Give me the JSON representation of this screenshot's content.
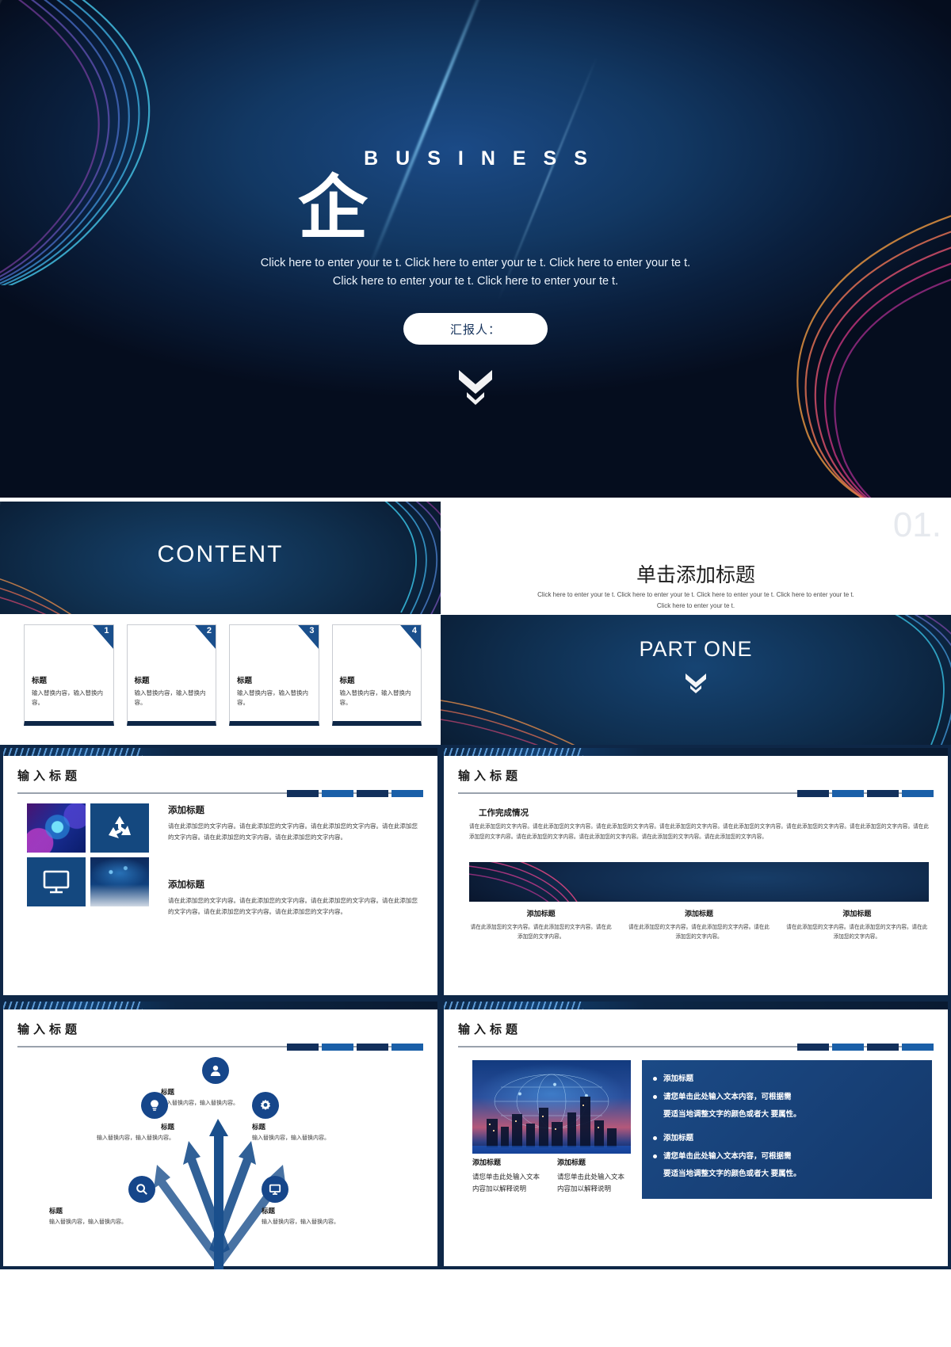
{
  "cover": {
    "word": "BUSINESS",
    "logo": "企",
    "subtitle": "Click here to enter your te t. Click here to enter your te t. Click here to enter your te t. Click here to enter your te t. Click here to enter your te t.",
    "presenter_label": "汇报人：",
    "colors": {
      "bg_deep": "#071428",
      "bg_blue": "#16436f",
      "accent_pink": "#c8336f",
      "accent_orange": "#e08a4a",
      "accent_cyan": "#35b6d8"
    }
  },
  "content_slide": {
    "hero_title": "CONTENT",
    "cards": [
      {
        "num": "1",
        "title": "标题",
        "text": "输入替换内容，输入替换内容。"
      },
      {
        "num": "2",
        "title": "标题",
        "text": "输入替换内容，输入替换内容。"
      },
      {
        "num": "3",
        "title": "标题",
        "text": "输入替换内容，输入替换内容。"
      },
      {
        "num": "4",
        "title": "标题",
        "text": "输入替换内容，输入替换内容。"
      }
    ]
  },
  "section_slide": {
    "number": "01.",
    "title": "单击添加标题",
    "subtitle": "Click here to enter your te t. Click here to enter your te t. Click here to enter your te t. Click here to enter your te t. Click here to enter your te t.",
    "band_title": "PART ONE"
  },
  "image_grid_slide": {
    "header": "输入标题",
    "tiles": [
      {
        "name": "globe-photo",
        "kind": "photo"
      },
      {
        "name": "recycle-icon",
        "kind": "icon"
      },
      {
        "name": "monitor-icon",
        "kind": "icon"
      },
      {
        "name": "network-hand-photo",
        "kind": "photo"
      }
    ],
    "blocks": [
      {
        "title": "添加标题",
        "text": "请在此添加您的文字内容。请在此添加您的文字内容。请在此添加您的文字内容。请在此添加您的文字内容。请在此添加您的文字内容。请在此添加您的文字内容。"
      },
      {
        "title": "添加标题",
        "text": "请在此添加您的文字内容。请在此添加您的文字内容。请在此添加您的文字内容。请在此添加您的文字内容。请在此添加您的文字内容。请在此添加您的文字内容。"
      }
    ]
  },
  "work_status_slide": {
    "header": "输入标题",
    "heading": "工作完成情况",
    "paragraph": "请在此添加您的文字内容。请在此添加您的文字内容。请在此添加您的文字内容。请在此添加您的文字内容。请在此添加您的文字内容。请在此添加您的文字内容。请在此添加您的文字内容。请在此添加您的文字内容。请在此添加您的文字内容。请在此添加您的文字内容。请在此添加您的文字内容。请在此添加您的文字内容。",
    "columns": [
      {
        "title": "添加标题",
        "text": "请在此添加您的文字内容。请在此添加您的文字内容。请在此添加您的文字内容。"
      },
      {
        "title": "添加标题",
        "text": "请在此添加您的文字内容。请在此添加您的文字内容。请在此添加您的文字内容。"
      },
      {
        "title": "添加标题",
        "text": "请在此添加您的文字内容。请在此添加您的文字内容。请在此添加您的文字内容。"
      }
    ]
  },
  "arrows_slide": {
    "header": "输入标题",
    "nodes": [
      {
        "icon": "person-icon",
        "title": "标题",
        "text": "输入替换内容，输入替换内容。"
      },
      {
        "icon": "lightbulb-icon",
        "title": "标题",
        "text": "输入替换内容，输入替换内容。"
      },
      {
        "icon": "gear-icon",
        "title": "标题",
        "text": "输入替换内容，输入替换内容。"
      },
      {
        "icon": "search-icon",
        "title": "标题",
        "text": "输入替换内容，输入替换内容。"
      },
      {
        "icon": "monitor-icon",
        "title": "标题",
        "text": "输入替换内容，输入替换内容。"
      }
    ]
  },
  "city_slide": {
    "header": "输入标题",
    "image_name": "city-network-photo",
    "bullets": [
      {
        "title": "添加标题",
        "body": ""
      },
      {
        "title": "请您单击此处输入文本内容，可根据需",
        "body": "要适当地调整文字的颜色或者大 要属性。"
      },
      {
        "title": "添加标题",
        "body": ""
      },
      {
        "title": "请您单击此处输入文本内容，可根据需",
        "body": "要适当地调整文字的颜色或者大 要属性。"
      }
    ],
    "columns": [
      {
        "title": "添加标题",
        "text": "请您单击此处输入文本内容加以解释说明"
      },
      {
        "title": "添加标题",
        "text": "请您单击此处输入文本内容加以解释说明"
      }
    ]
  }
}
